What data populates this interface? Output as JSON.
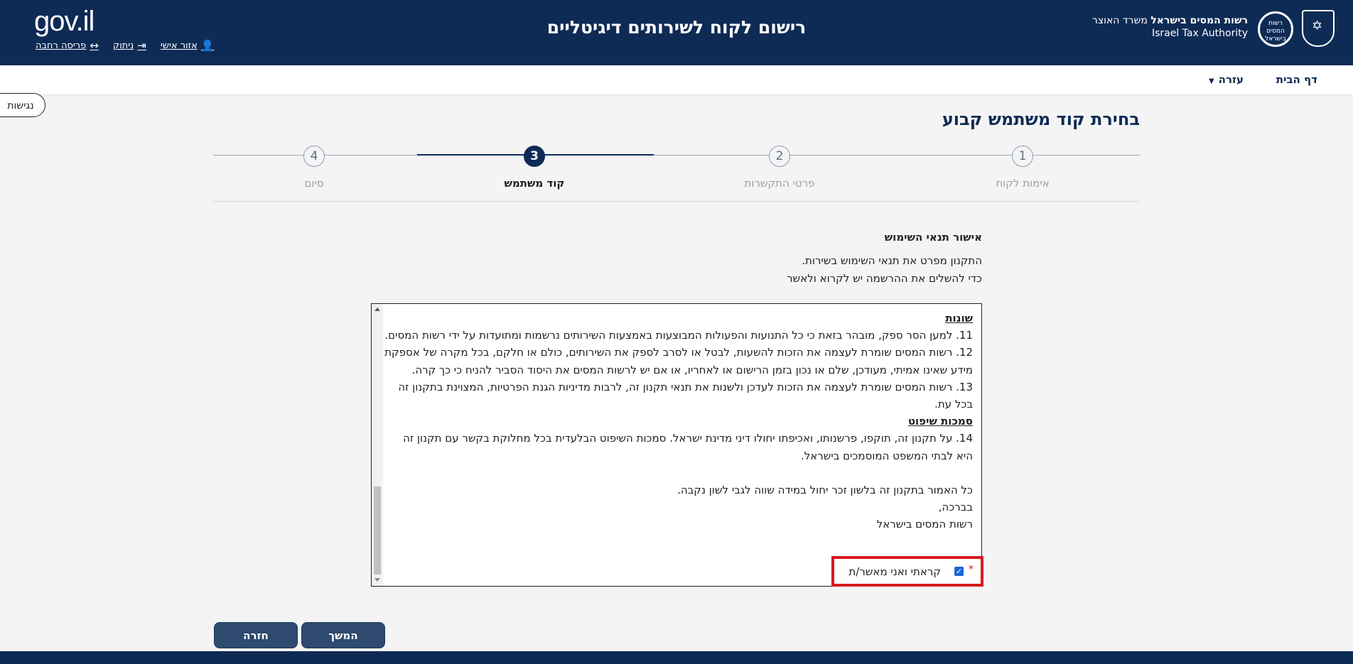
{
  "header": {
    "logo": "gov.il",
    "title": "רישום לקוח לשירותים דיגיטליים",
    "authority_he_bold": "רשות המסים בישראל",
    "authority_he_rest": "משרד האוצר",
    "authority_en": "Israel Tax Authority",
    "circle_logo_text": "רשות המסים בישראל",
    "links": {
      "personal_area": "אזור אישי",
      "logout": "ניתוק",
      "wide_layout": "פריסה רחבה"
    }
  },
  "nav": {
    "home": "דף הבית",
    "help": "עזרה",
    "accessibility": "נגישות"
  },
  "page": {
    "title": "בחירת קוד משתמש קבוע"
  },
  "stepper": {
    "steps": [
      {
        "number": "1",
        "label": "אימות לקוח"
      },
      {
        "number": "2",
        "label": "פרטי התקשרות"
      },
      {
        "number": "3",
        "label": "קוד משתמש"
      },
      {
        "number": "4",
        "label": "סיום"
      }
    ],
    "current_step": 3
  },
  "terms": {
    "heading": "אישור תנאי השימוש",
    "intro_line1": "התקנון מפרט את תנאי השימוש בשירות.",
    "intro_line2": "כדי להשלים את ההרשמה יש לקרוא ולאשר",
    "section_misc": "שונות",
    "p11": "11. למען הסר ספק, מובהר בזאת כי כל התנועות והפעולות המבוצעות באמצעות השירותים נרשמות ומתועדות על ידי רשות המסים.",
    "p12": "12. רשות המסים שומרת לעצמה את הזכות להשעות, לבטל או לסרב לספק את השירותים, כולם או חלקם, בכל מקרה של אספקת מידע שאינו אמיתי, מעודכן, שלם או נכון בזמן הרישום או לאחריו, או אם יש לרשות המסים את היסוד הסביר להניח כי כך קרה.",
    "p13": "13. רשות המסים שומרת לעצמה את הזכות לעדכן ולשנות את תנאי תקנון זה, לרבות מדיניות הגנת הפרטיות, המצוינת בתקנון זה בכל עת.",
    "section_jurisdiction": "סמכות שיפוט",
    "p14": "14. על תקנון זה, תוקפו, פרשנותו, ואכיפתו יחולו דיני מדינת ישראל. סמכות השיפוט הבלעדית בכל מחלוקת בקשר עם תקנון זה היא לבתי המשפט המוסמכים בישראל.",
    "gender_note": "כל האמור בתקנון זה בלשון זכר יחול במידה שווה לגבי לשון נקבה.",
    "regards": "בברכה,",
    "signature": "רשות המסים בישראל",
    "required_mark": "*",
    "confirm_label": "קראתי ואני מאשר/ת",
    "confirm_checked": true
  },
  "buttons": {
    "next": "המשך",
    "back": "חזרה"
  }
}
